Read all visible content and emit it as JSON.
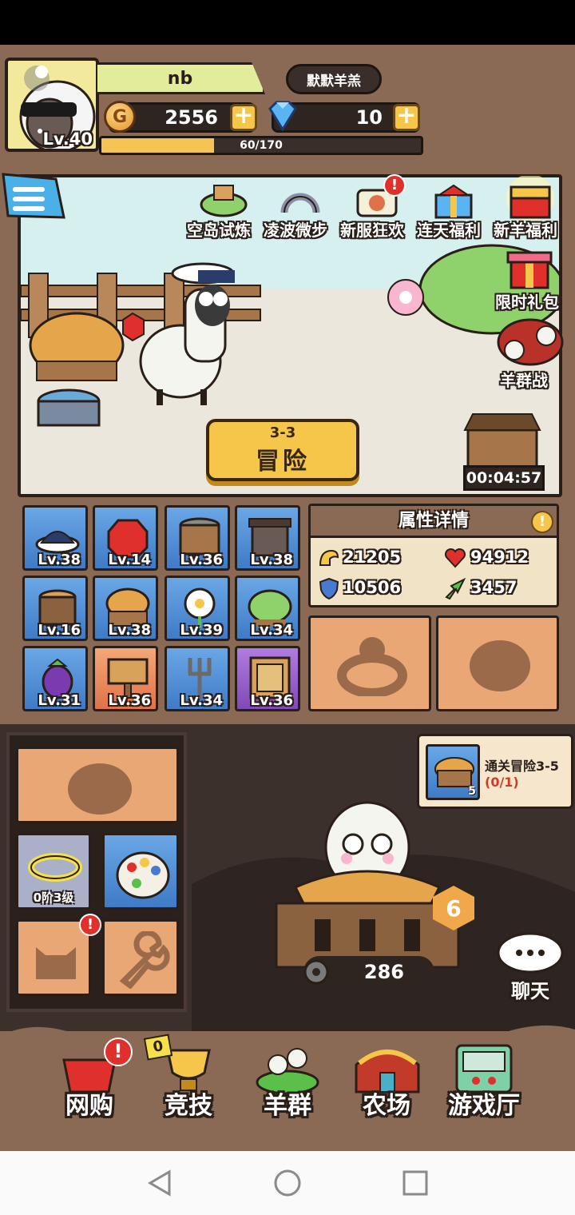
{
  "player": {
    "name": "nb",
    "level": "Lv.40",
    "guild": "默默羊羔",
    "gold": "2556",
    "gems": "10",
    "xp_text": "60/170",
    "xp_fraction": 0.353
  },
  "events": [
    {
      "label": "空岛试炼",
      "icon": "island-icon"
    },
    {
      "label": "凌波微步",
      "icon": "horseshoe-icon"
    },
    {
      "label": "新服狂欢",
      "icon": "carnival-icon",
      "badge": "!"
    },
    {
      "label": "连天福利",
      "icon": "gift-box-icon"
    },
    {
      "label": "新羊福利",
      "icon": "treasure-chest-icon"
    }
  ],
  "side_events": [
    {
      "label": "限时礼包",
      "icon": "gift-icon"
    },
    {
      "label": "羊群战",
      "icon": "battle-icon"
    }
  ],
  "adventure": {
    "stage": "3-3",
    "label": "冒险"
  },
  "timer": "00:04:57",
  "equipment": [
    {
      "level": "Lv.38",
      "icon": "captain-hat-icon",
      "rarity": "blue"
    },
    {
      "level": "Lv.14",
      "icon": "stop-sign-icon",
      "rarity": "blue"
    },
    {
      "level": "Lv.36",
      "icon": "well-icon",
      "rarity": "blue"
    },
    {
      "level": "Lv.38",
      "icon": "crate-icon",
      "rarity": "blue"
    },
    {
      "level": "Lv.16",
      "icon": "stump-icon",
      "rarity": "blue"
    },
    {
      "level": "Lv.38",
      "icon": "hay-icon",
      "rarity": "blue"
    },
    {
      "level": "Lv.39",
      "icon": "flower-icon",
      "rarity": "blue"
    },
    {
      "level": "Lv.34",
      "icon": "bush-icon",
      "rarity": "blue"
    },
    {
      "level": "Lv.31",
      "icon": "eggplant-icon",
      "rarity": "blue"
    },
    {
      "level": "Lv.36",
      "icon": "signboard-icon",
      "rarity": "orange"
    },
    {
      "level": "Lv.34",
      "icon": "pitchfork-icon",
      "rarity": "blue"
    },
    {
      "level": "Lv.36",
      "icon": "gate-icon",
      "rarity": "purple"
    }
  ],
  "attributes": {
    "title": "属性详情",
    "attack": "21205",
    "hp": "94912",
    "defense": "10506",
    "speed": "3457"
  },
  "halo": {
    "label": "0阶3级"
  },
  "quest": {
    "title": "通关冒险3-5",
    "progress": "(0/1)",
    "reward_count": "5"
  },
  "gear_count": "286",
  "pen_level": "6",
  "chat": {
    "label": "聊天"
  },
  "nav": [
    {
      "label": "网购",
      "icon": "basket-icon",
      "badge": "!"
    },
    {
      "label": "竞技",
      "icon": "trophy-icon",
      "badge": "0"
    },
    {
      "label": "羊群",
      "icon": "flock-icon"
    },
    {
      "label": "农场",
      "icon": "barn-icon"
    },
    {
      "label": "游戏厅",
      "icon": "arcade-icon"
    }
  ],
  "colors": {
    "frame": "#8a6a55",
    "gold_button": "#f5c64a",
    "badge_red": "#e0302c",
    "equip_blue": "#3f7bc6",
    "equip_orange": "#e0724a",
    "equip_purple": "#7f4ab8"
  }
}
